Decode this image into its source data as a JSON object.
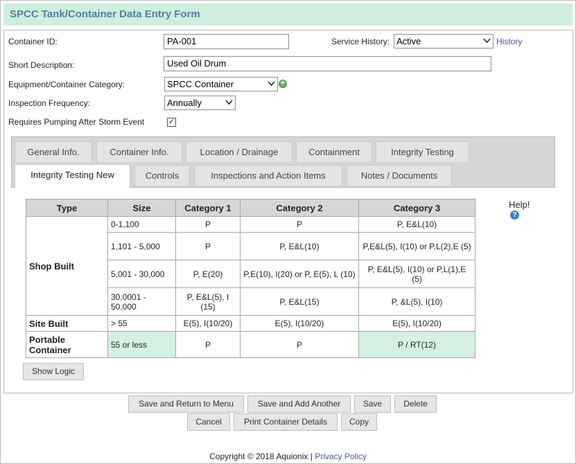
{
  "title": "SPCC Tank/Container Data Entry Form",
  "fields": {
    "container_id_label": "Container ID:",
    "container_id_value": "PA-001",
    "service_history_label": "Service History:",
    "service_history_value": "Active",
    "history_link": "History",
    "short_desc_label": "Short Description:",
    "short_desc_value": "Used Oil Drum",
    "category_label": "Equipment/Container Category:",
    "category_value": "SPCC Container",
    "inspection_freq_label": "Inspection Frequency:",
    "inspection_freq_value": "Annually",
    "pumping_label": "Requires Pumping After Storm Event",
    "pumping_checked": true
  },
  "tabs_row1": [
    "General Info.",
    "Container Info.",
    "Location / Drainage",
    "Containment",
    "Integrity Testing"
  ],
  "tabs_row2": [
    "Integrity Testing New",
    "Controls",
    "Inspections and Action Items",
    "Notes / Documents"
  ],
  "active_tab": "Integrity Testing New",
  "table": {
    "headers": [
      "Type",
      "Size",
      "Category 1",
      "Category 2",
      "Category 3"
    ],
    "shop_built_label": "Shop Built",
    "shop_rows": [
      {
        "size": "0-1,100",
        "c1": "P",
        "c2": "P",
        "c3": "P, E&L(10)"
      },
      {
        "size": "1,101 - 5,000",
        "c1": "P",
        "c2": "P, E&L(10)",
        "c3": "P,E&L(5), I(10) or P,L(2),E (5)"
      },
      {
        "size": "5,001 - 30,000",
        "c1": "P, E(20)",
        "c2": "P,E(10), I(20) or P, E(5), L (10)",
        "c3": "P, E&L(5), I(10) or P,L(1),E (5)"
      },
      {
        "size": "30,0001 - 50,000",
        "c1": "P, E&L(5), I (15)",
        "c2": "P, E&L(15)",
        "c3": "P, &L(5), I(10)"
      }
    ],
    "site_built": {
      "type": "Site Built",
      "size": "> 55",
      "c1": "E(5), I(10/20)",
      "c2": "E(5), I(10/20)",
      "c3": "E(5), I(10/20)"
    },
    "portable": {
      "type": "Portable Container",
      "size": "55 or less",
      "c1": "P",
      "c2": "P",
      "c3": "P / RT(12)"
    }
  },
  "help_label": "Help!",
  "show_logic": "Show Logic",
  "buttons": {
    "save_return": "Save and Return to Menu",
    "save_add": "Save and Add Another",
    "save": "Save",
    "delete": "Delete",
    "cancel": "Cancel",
    "print": "Print Container Details",
    "copy": "Copy"
  },
  "footer": {
    "copyright": "Copyright © 2018 Aquionix |",
    "privacy": "Privacy Policy"
  }
}
